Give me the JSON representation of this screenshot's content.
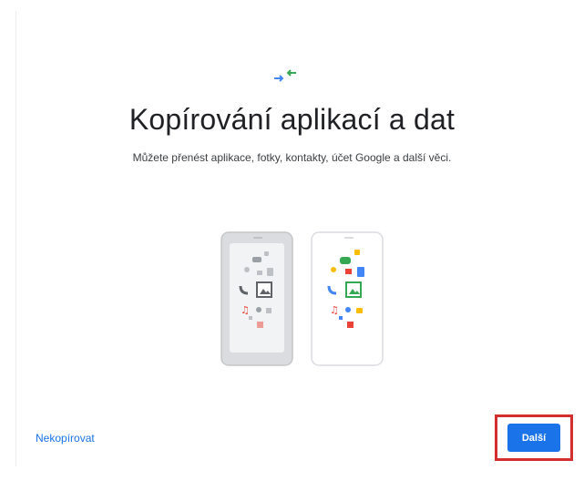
{
  "header": {
    "icon": "transfer-arrows-icon",
    "title": "Kopírování aplikací a dat",
    "subtitle": "Můžete přenést aplikace, fotky, kontakty, účet Google a další věci."
  },
  "illustration": {
    "icon": "phone-transfer-illustration",
    "colors": {
      "old_phone": "#dadce0",
      "new_phone": "#ffffff",
      "green": "#34a853",
      "blue": "#4285f4",
      "yellow": "#fbbc04",
      "red": "#ea4335"
    }
  },
  "footer": {
    "skip_label": "Nekopírovat",
    "next_label": "Další"
  },
  "colors": {
    "accent": "#1a73e8",
    "highlight": "#d32f2f"
  }
}
